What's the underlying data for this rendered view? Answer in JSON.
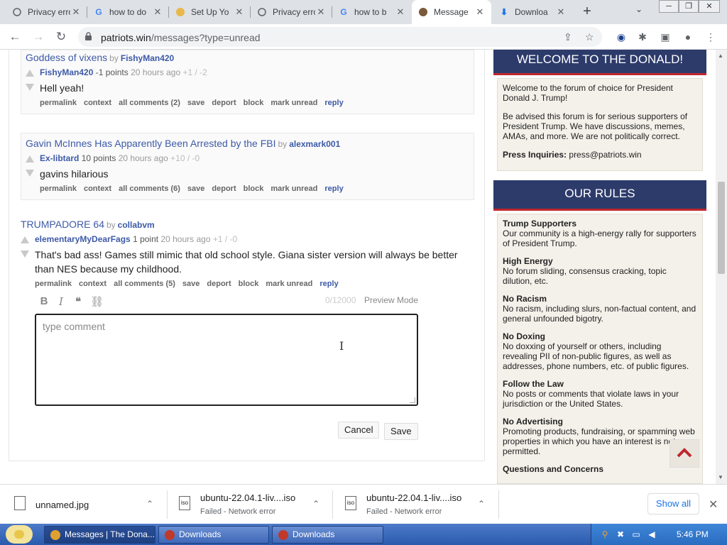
{
  "browser": {
    "tabs": [
      {
        "title": "Privacy error",
        "icon": "warning-icon",
        "active": false
      },
      {
        "title": "how to do",
        "icon": "google-icon",
        "active": false
      },
      {
        "title": "Set Up Yo",
        "icon": "site-icon",
        "active": false
      },
      {
        "title": "Privacy error",
        "icon": "warning-icon",
        "active": false
      },
      {
        "title": "how to b",
        "icon": "google-icon",
        "active": false
      },
      {
        "title": "Message",
        "icon": "site-icon",
        "active": true
      },
      {
        "title": "Downloa",
        "icon": "download-icon",
        "active": false
      }
    ],
    "url_host": "patriots.win",
    "url_path": "/messages?type=unread"
  },
  "messages": [
    {
      "title": "Goddess of vixens",
      "by": "by",
      "post_author": "FishyMan420",
      "comment_user": "FishyMan420",
      "points": "-1 points",
      "time": "20 hours ago",
      "votes": "+1 / -2",
      "body": "Hell yeah!",
      "actions": [
        "permalink",
        "context",
        "all comments (2)",
        "save",
        "deport",
        "block",
        "mark unread",
        "reply"
      ]
    },
    {
      "title": "Gavin McInnes Has Apparently Been Arrested by the FBI",
      "by": "by",
      "post_author": "alexmark001",
      "comment_user": "Ex-libtard",
      "points": "10 points",
      "time": "20 hours ago",
      "votes": "+10 / -0",
      "body": "gavins hilarious",
      "actions": [
        "permalink",
        "context",
        "all comments (6)",
        "save",
        "deport",
        "block",
        "mark unread",
        "reply"
      ]
    },
    {
      "title": "TRUMPADORE 64",
      "by": "by",
      "post_author": "collabvm",
      "comment_user": "elementaryMyDearFags",
      "points": "1 point",
      "time": "20 hours ago",
      "votes": "+1 / -0",
      "body": "That's bad ass! Games still mimic that old school style. Giana sister version will always be better than NES because my childhood.",
      "actions": [
        "permalink",
        "context",
        "all comments (5)",
        "save",
        "deport",
        "block",
        "mark unread",
        "reply"
      ]
    }
  ],
  "editor": {
    "char_count": "0/12000",
    "preview": "Preview Mode",
    "placeholder": "type comment",
    "cancel": "Cancel",
    "save": "Save"
  },
  "sidebar": {
    "welcome_title": "WELCOME TO THE DONALD!",
    "welcome_p1": "Welcome to the forum of choice for President Donald J. Trump!",
    "welcome_p2": "Be advised this forum is for serious supporters of President Trump. We have discussions, memes, AMAs, and more. We are not politically correct.",
    "press_label": "Press Inquiries:",
    "press_email": "press@patriots.win",
    "rules_title": "OUR RULES",
    "rules": [
      {
        "title": "Trump Supporters",
        "text": "Our community is a high-energy rally for supporters of President Trump."
      },
      {
        "title": "High Energy",
        "text": "No forum sliding, consensus cracking, topic dilution, etc."
      },
      {
        "title": "No Racism",
        "text": "No racism, including slurs, non-factual content, and general unfounded bigotry."
      },
      {
        "title": "No Doxing",
        "text": "No doxxing of yourself or others, including revealing PII of non-public figures, as well as addresses, phone numbers, etc. of public figures."
      },
      {
        "title": "Follow the Law",
        "text": "No posts or comments that violate laws in your jurisdiction or the United States."
      },
      {
        "title": "No Advertising",
        "text": "Promoting products, fundraising, or spamming web properties in which you have an interest is not permitted."
      },
      {
        "title": "Questions and Concerns",
        "text": ""
      }
    ]
  },
  "downloads": {
    "items": [
      {
        "name": "unnamed.jpg",
        "status": ""
      },
      {
        "name": "ubuntu-22.04.1-liv....iso",
        "status": "Failed - Network error"
      },
      {
        "name": "ubuntu-22.04.1-liv....iso",
        "status": "Failed - Network error"
      }
    ],
    "show_all": "Show all"
  },
  "taskbar": {
    "buttons": [
      {
        "label": "Messages | The Dona...",
        "active": true
      },
      {
        "label": "Downloads",
        "active": false
      },
      {
        "label": "Downloads",
        "active": false
      }
    ],
    "clock": "5:46 PM"
  },
  "colors": {
    "link": "#3d5aa8",
    "sidebar_header": "#2d3b6b",
    "sidebar_header_border": "#c0272d",
    "sidebar_body": "#f4f1ea",
    "taskbar": "#2a5aad"
  }
}
